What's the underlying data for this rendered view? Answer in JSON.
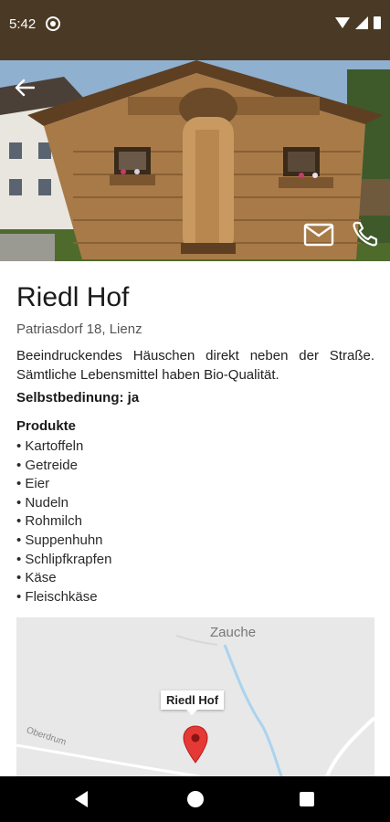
{
  "status_bar": {
    "time": "5:42",
    "icons": [
      "app-notification-icon",
      "wifi-icon",
      "signal-icon",
      "battery-icon"
    ]
  },
  "header": {
    "back_icon": "arrow-back-icon",
    "mail_icon": "mail-icon",
    "phone_icon": "phone-icon"
  },
  "farm": {
    "name": "Riedl Hof",
    "address": "Patriasdorf 18, Lienz",
    "description": "Beeindruckendes Häuschen direkt neben der Straße. Sämtliche Lebensmittel haben Bio-Qualität.",
    "self_service": "Selbstbedinung: ja",
    "products_heading": "Produkte",
    "products": [
      "Kartoffeln",
      "Getreide",
      "Eier",
      "Nudeln",
      "Rohmilch",
      "Suppenhuhn",
      "Schlipfkrapfen",
      "Käse",
      "Fleischkäse"
    ]
  },
  "map": {
    "place_label": "Zauche",
    "street_label": "Oberdrum",
    "marker_label": "Riedl Hof",
    "pin_color": "#e53935"
  },
  "nav_bar": {
    "icons": [
      "nav-back-icon",
      "nav-home-icon",
      "nav-recents-icon"
    ]
  },
  "colors": {
    "status_bar": "#4a3a25",
    "nav_bar": "#000000"
  }
}
